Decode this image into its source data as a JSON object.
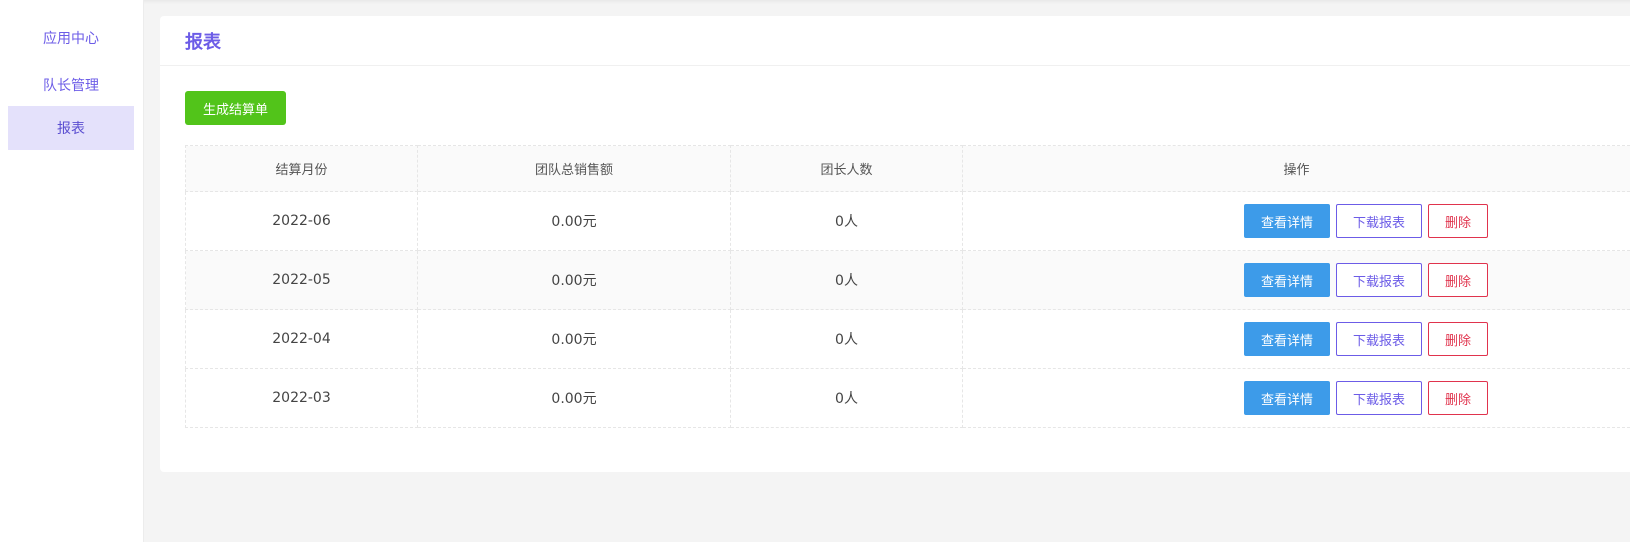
{
  "sidebar": {
    "items": [
      {
        "label": "应用中心"
      },
      {
        "label": "队长管理"
      },
      {
        "label": "报表"
      }
    ]
  },
  "card": {
    "title": "报表",
    "generate_button": "生成结算单"
  },
  "table": {
    "headers": [
      "结算月份",
      "团队总销售额",
      "团长人数",
      "操作"
    ],
    "rows": [
      {
        "month": "2022-06",
        "sales": "0.00元",
        "leaders": "0人"
      },
      {
        "month": "2022-05",
        "sales": "0.00元",
        "leaders": "0人"
      },
      {
        "month": "2022-04",
        "sales": "0.00元",
        "leaders": "0人"
      },
      {
        "month": "2022-03",
        "sales": "0.00元",
        "leaders": "0人"
      }
    ],
    "actions": {
      "detail": "查看详情",
      "download": "下载报表",
      "delete": "删除"
    }
  },
  "colors": {
    "accent": "#6c5ce7",
    "success": "#52c41a",
    "primary": "#3d9be9",
    "danger": "#e0334d"
  }
}
